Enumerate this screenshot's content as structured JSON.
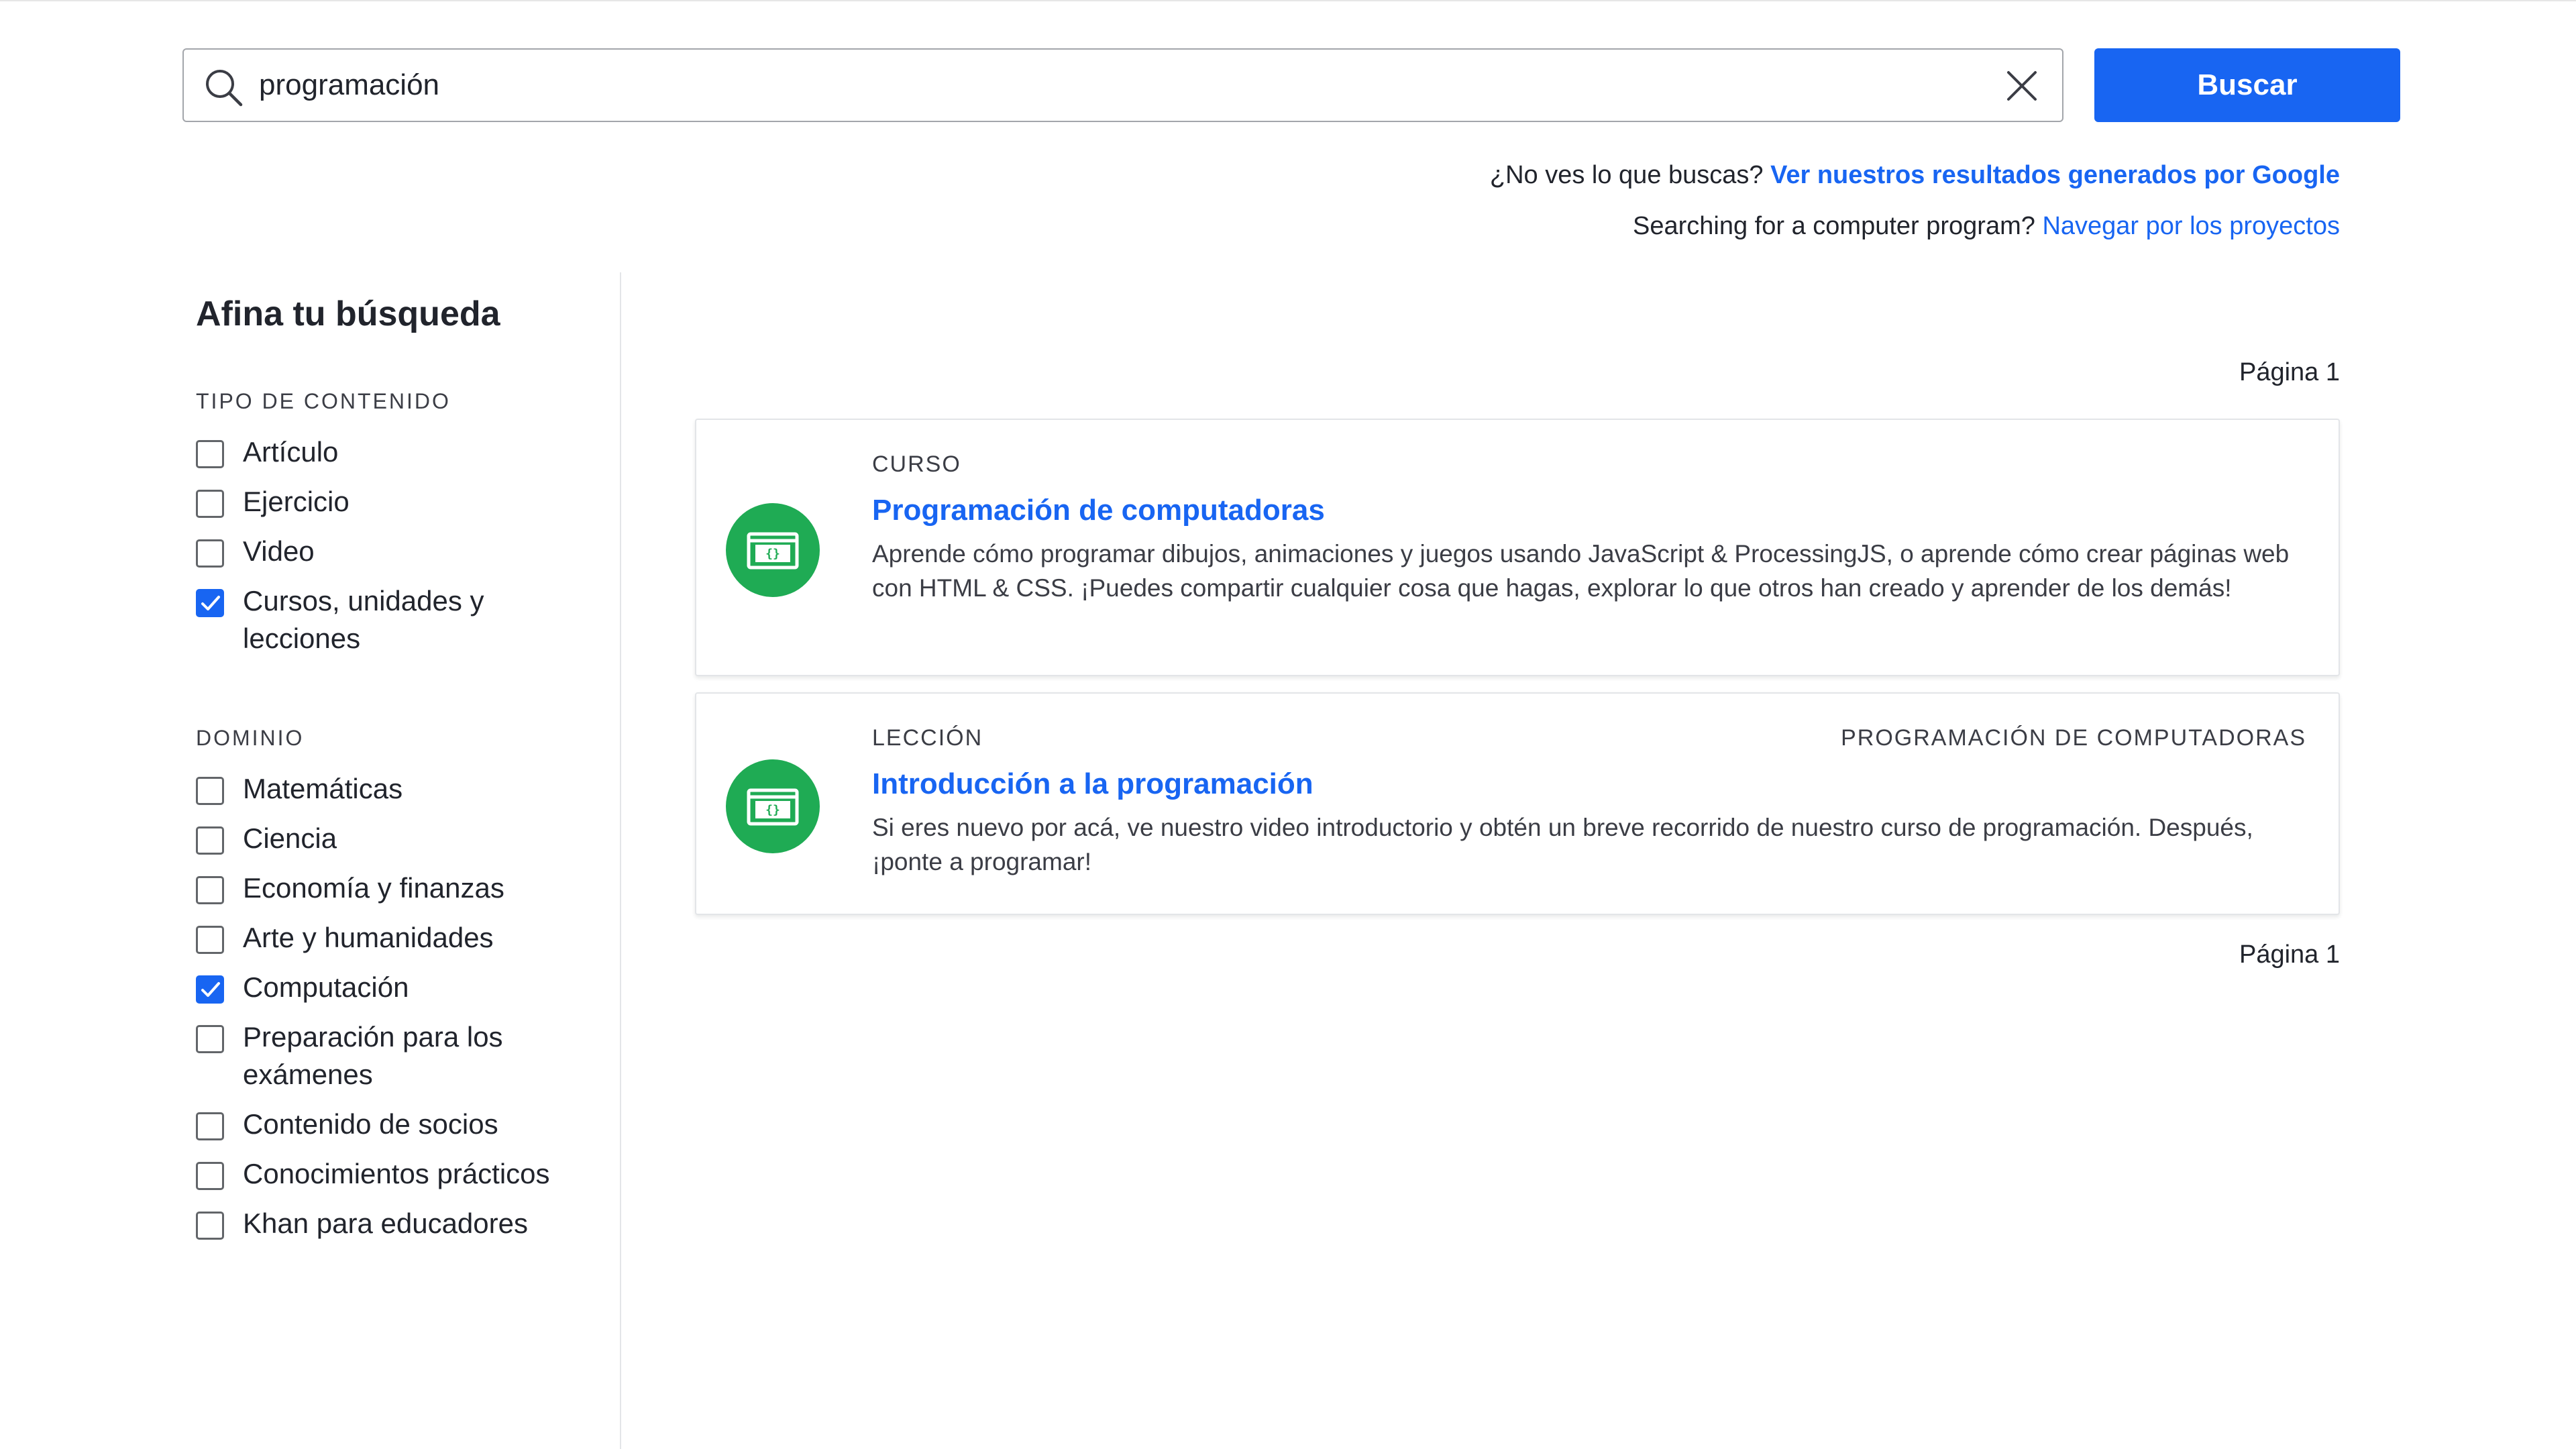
{
  "search": {
    "value": "programación",
    "button_label": "Buscar"
  },
  "hints": {
    "google_prefix": "¿No ves lo que buscas?",
    "google_link": "Ver nuestros resultados generados por Google",
    "projects_prefix": "Searching for a computer program?",
    "projects_link": "Navegar por los proyectos"
  },
  "sidebar": {
    "title": "Afina tu búsqueda",
    "content_type": {
      "title": "TIPO DE CONTENIDO",
      "items": [
        {
          "label": "Artículo",
          "checked": false
        },
        {
          "label": "Ejercicio",
          "checked": false
        },
        {
          "label": "Video",
          "checked": false
        },
        {
          "label": "Cursos, unidades y lecciones",
          "checked": true
        }
      ]
    },
    "domain": {
      "title": "DOMINIO",
      "items": [
        {
          "label": "Matemáticas",
          "checked": false
        },
        {
          "label": "Ciencia",
          "checked": false
        },
        {
          "label": "Economía y finanzas",
          "checked": false
        },
        {
          "label": "Arte y humanidades",
          "checked": false
        },
        {
          "label": "Computación",
          "checked": true
        },
        {
          "label": "Preparación para los exámenes",
          "checked": false
        },
        {
          "label": "Contenido de socios",
          "checked": false
        },
        {
          "label": "Conocimientos prácticos",
          "checked": false
        },
        {
          "label": "Khan para educadores",
          "checked": false
        }
      ]
    }
  },
  "results": {
    "page_top": "Página 1",
    "page_bottom": "Página 1",
    "items": [
      {
        "kind": "CURSO",
        "context": "",
        "title": "Programación de computadoras",
        "description": "Aprende cómo programar dibujos, animaciones y juegos usando JavaScript & ProcessingJS, o aprende cómo crear páginas web con HTML & CSS. ¡Puedes compartir cualquier cosa que hagas, explorar lo que otros han creado y aprender de los demás!",
        "icon": "code-window-icon"
      },
      {
        "kind": "LECCIÓN",
        "context": "PROGRAMACIÓN DE COMPUTADORAS",
        "title": "Introducción a la programación",
        "description": "Si eres nuevo por acá, ve nuestro video introductorio y obtén un breve recorrido de nuestro curso de programación. Después, ¡ponte a programar!",
        "icon": "code-window-icon"
      }
    ]
  },
  "colors": {
    "primary": "#1865f2",
    "icon_green": "#1fab54",
    "text": "#21242c"
  }
}
